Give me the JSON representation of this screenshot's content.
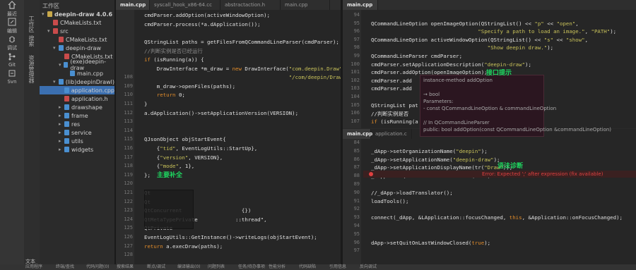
{
  "activity": [
    {
      "label": "最近",
      "icon": "home-icon"
    },
    {
      "label": "编辑",
      "icon": "edit-icon"
    },
    {
      "label": "调试",
      "icon": "bug-icon"
    },
    {
      "label": "Git",
      "icon": "git-icon"
    },
    {
      "label": "Svn",
      "icon": "svn-icon"
    }
  ],
  "side_tabs": [
    "工作区",
    "搜索",
    "资源管理器"
  ],
  "sidebar": {
    "title": "工作区",
    "items": [
      {
        "label": "deepin-draw 4.0.6",
        "lvl": 0,
        "arrow": "▾",
        "bold": true,
        "color": "#c8a84a"
      },
      {
        "label": "CMakeLists.txt",
        "lvl": 1,
        "arrow": "",
        "color": "#c94b4b"
      },
      {
        "label": "src",
        "lvl": 1,
        "arrow": "▾",
        "color": "#c94b4b"
      },
      {
        "label": "CMakeLists.txt",
        "lvl": 2,
        "arrow": "",
        "color": "#c94b4b"
      },
      {
        "label": "deepin-draw",
        "lvl": 2,
        "arrow": "▾",
        "color": "#4a8fd0"
      },
      {
        "label": "CMakeLists.txt",
        "lvl": 3,
        "arrow": "",
        "color": "#c94b4b"
      },
      {
        "label": "(exe)deepin-draw",
        "lvl": 3,
        "arrow": "▾",
        "color": "#4a8fd0"
      },
      {
        "label": "main.cpp",
        "lvl": 4,
        "arrow": "",
        "color": "#4a8fd0"
      },
      {
        "label": "(lib)deepinDrawl)",
        "lvl": 2,
        "arrow": "▾",
        "color": "#4a8fd0"
      },
      {
        "label": "application.cpp",
        "lvl": 3,
        "arrow": "",
        "color": "#4a8fd0",
        "selected": true
      },
      {
        "label": "application.h",
        "lvl": 3,
        "arrow": "",
        "color": "#c94b4b"
      },
      {
        "label": "drawshape",
        "lvl": 3,
        "arrow": "▸",
        "color": "#4a8fd0"
      },
      {
        "label": "frame",
        "lvl": 3,
        "arrow": "▸",
        "color": "#4a8fd0"
      },
      {
        "label": "res",
        "lvl": 3,
        "arrow": "▸",
        "color": "#4a8fd0"
      },
      {
        "label": "service",
        "lvl": 3,
        "arrow": "▸",
        "color": "#4a8fd0"
      },
      {
        "label": "utils",
        "lvl": 3,
        "arrow": "▸",
        "color": "#4a8fd0"
      },
      {
        "label": "widgets",
        "lvl": 3,
        "arrow": "▸",
        "color": "#4a8fd0"
      }
    ]
  },
  "left_tabs": [
    "main.cpp",
    "syscall_hook_x86-64.cc",
    "abstractaction.h",
    "main.cpp"
  ],
  "left_lines": [
    {
      "n": "",
      "t": "cmdParser.addOption(activeWindowOption);"
    },
    {
      "n": "",
      "t": "cmdParser.process(*a.dApplication());"
    },
    {
      "n": "",
      "t": ""
    },
    {
      "n": "",
      "t": "QStringList paths = getFilesFromQCommandLineParser(cmdParser);"
    },
    {
      "n": "",
      "t": "//判断实例是否已经运行",
      "cls": "c"
    },
    {
      "n": "",
      "t": "if (isRunning(a)) {"
    },
    {
      "n": "",
      "t": "    DrawInterface *m_draw = new DrawInterface(\"com.deepin.Draw\","
    },
    {
      "n": "108",
      "t": "                                              \"/com/deepin/Draw\", QDBusConnection::sessionBus(), &a);"
    },
    {
      "n": "109",
      "t": "    m_draw->openFiles(paths);"
    },
    {
      "n": "110",
      "t": "    return 0;"
    },
    {
      "n": "111",
      "t": "}"
    },
    {
      "n": "112",
      "t": "a.dApplication()->setApplicationVersion(VERSION);"
    },
    {
      "n": "113",
      "t": ""
    },
    {
      "n": "114",
      "t": ""
    },
    {
      "n": "115",
      "t": "QJsonObject objStartEvent{"
    },
    {
      "n": "116",
      "t": "    {\"tid\", EventLogUtils::StartUp},"
    },
    {
      "n": "117",
      "t": "    {\"version\", VERSION},"
    },
    {
      "n": "118",
      "t": "    {\"mode\", 1},"
    },
    {
      "n": "119",
      "t": "};"
    },
    {
      "n": "120",
      "t": ""
    },
    {
      "n": "121",
      "t": "Qt"
    },
    {
      "n": "122",
      "t": "Qt"
    },
    {
      "n": "123",
      "t": "QtConcurrent                   {})"
    },
    {
      "n": "124",
      "t": "QtMetaTypePrivate            ::thread\","
    },
    {
      "n": "125",
      "t": "QtPrivate"
    },
    {
      "n": "126",
      "t": "EventLogUtils::GetInstance()->writeLogs(objStartEvent);"
    },
    {
      "n": "127",
      "t": "return a.execDraw(paths);"
    },
    {
      "n": "128",
      "t": ""
    }
  ],
  "rt_tabs": [
    "main.cpp"
  ],
  "rt_lines": [
    {
      "n": "94",
      "t": ""
    },
    {
      "n": "95",
      "t": "QCommandLineOption openImageOption(QStringList() << \"p\" << \"open\","
    },
    {
      "n": "96",
      "t": "                                  \"Specify a path to load an image.\", \"PATH\");"
    },
    {
      "n": "97",
      "t": "QCommandLineOption activeWindowOption(QStringList() << \"s\" << \"show\","
    },
    {
      "n": "98",
      "t": "                                     \"Show deepin draw.\");"
    },
    {
      "n": "99",
      "t": "QCommandLineParser cmdParser;"
    },
    {
      "n": "100",
      "t": "cmdParser.setApplicationDescription(\"deepin-draw\");"
    },
    {
      "n": "101",
      "t": "cmdParser.addOption(openImageOption);"
    },
    {
      "n": "102",
      "t": "cmdParser.add"
    },
    {
      "n": "103",
      "t": "cmdParser.add"
    },
    {
      "n": "104",
      "t": ""
    },
    {
      "n": "105",
      "t": "QStringList pat"
    },
    {
      "n": "106",
      "t": "//判断实例是否"
    },
    {
      "n": "107",
      "t": "if (isRunning(a"
    }
  ],
  "rb_tabs": [
    "main.cpp",
    "application.c"
  ],
  "rb_lines": [
    {
      "n": "84",
      "t": ""
    },
    {
      "n": "85",
      "t": "_dApp->setOrganizationName(\"deepin\");"
    },
    {
      "n": "86",
      "t": "_dApp->setApplicationName(\"deepin-draw\");"
    },
    {
      "n": "87",
      "t": "_dApp->setApplicationDisplayName(tr(\"Draw\"));"
    },
    {
      "n": "88",
      "t": "_dApp->setQuitOnLastWindowClosed(true)"
    },
    {
      "n": "89",
      "t": ""
    },
    {
      "n": "90",
      "t": "//_dApp->loadTranslator();"
    },
    {
      "n": "91",
      "t": "loadTools();"
    },
    {
      "n": "92",
      "t": ""
    },
    {
      "n": "93",
      "t": "connect(_dApp, &LApplication::focusChanged, this, &Application::onFocusChanged);"
    },
    {
      "n": "94",
      "t": ""
    },
    {
      "n": "95",
      "t": ""
    },
    {
      "n": "96",
      "t": "dApp->setQuitOnLastWindowClosed(true);"
    },
    {
      "n": "97",
      "t": ""
    }
  ],
  "error_text": "Error: Expected ';' after expression (fix available)",
  "tooltip": {
    "lines": [
      "instance-method addOption",
      "",
      "→ bool",
      "Parameters:",
      "- const QCommandLineOption & commandLineOption",
      "",
      "// In QCommandLineParser",
      "public: bool addOption(const QCommandLineOption &commandLineOption)"
    ]
  },
  "annotations": {
    "interface": "接口提示",
    "completion": "主要补全",
    "diagnostics": "语法诊断"
  },
  "bottom": {
    "label": "文本",
    "tabs": [
      "应用程序",
      "终端/查找",
      "代码问题(0)",
      "搜索结果",
      "断点/调试",
      "编译输出(0)",
      "问题列表",
      "任务/待办事项",
      "性能分析",
      "代码缺陷",
      "引用信息",
      "反向调试"
    ]
  },
  "colors": {
    "accent": "#1ed760",
    "error": "#e04040",
    "selected": "#3b6fb0"
  }
}
